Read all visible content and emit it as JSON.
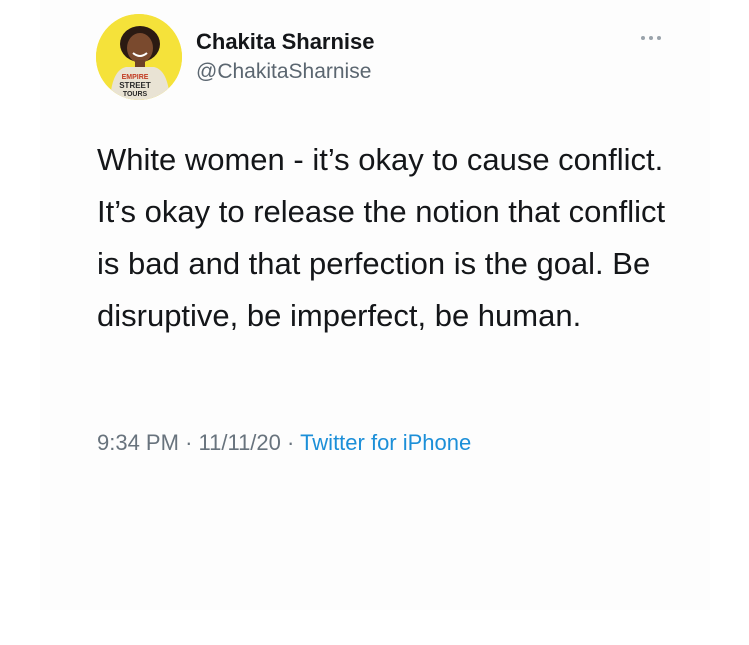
{
  "tweet": {
    "author": {
      "display_name": "Chakita Sharnise",
      "handle": "@ChakitaSharnise",
      "avatar_shirt_text": [
        "EMPIRE",
        "STREET",
        "TOURS"
      ]
    },
    "text": "White women - it’s okay to cause conflict. It’s okay to release the notion that conflict is bad and that perfection is the goal. Be disruptive, be imperfect, be human.",
    "time": "9:34 PM",
    "separator": "·",
    "date": "11/11/20",
    "source": "Twitter for iPhone",
    "more_icon": "more-horizontal-icon"
  },
  "colors": {
    "name": "#141619",
    "handle": "#5b6670",
    "meta": "#68737d",
    "link": "#1c8fd8",
    "avatar_bg": "#f5e23a"
  }
}
